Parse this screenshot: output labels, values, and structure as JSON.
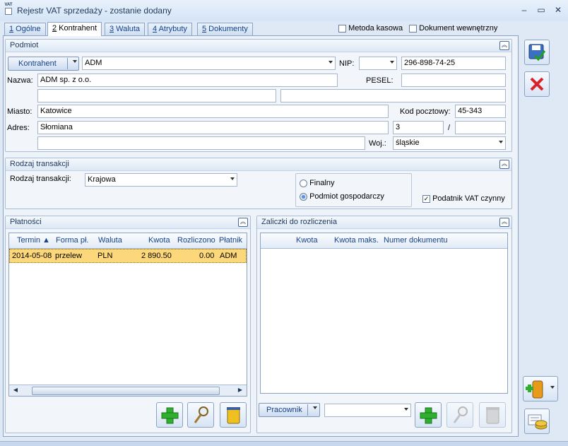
{
  "window": {
    "title": "Rejestr VAT sprzedaży - zostanie dodany",
    "minimize": "–",
    "maximize": "▭",
    "close": "✕"
  },
  "tabs": [
    {
      "num": "1",
      "label": " Ogólne"
    },
    {
      "num": "2",
      "label": " Kontrahent"
    },
    {
      "num": "3",
      "label": " Waluta"
    },
    {
      "num": "4",
      "label": " Atrybuty"
    },
    {
      "num": "5",
      "label": " Dokumenty"
    }
  ],
  "checks": {
    "metoda_kasowa": "Metoda kasowa",
    "dok_wewn": "Dokument wewnętrzny"
  },
  "podmiot": {
    "title": "Podmiot",
    "kontrahent_btn": "Kontrahent",
    "kontrahent_value": "ADM",
    "nip_label": "NIP:",
    "nip_prefix": "",
    "nip_value": "296-898-74-25",
    "nazwa_label": "Nazwa:",
    "nazwa_value": "ADM sp. z o.o.",
    "pesel_label": "PESEL:",
    "pesel_value": "",
    "miasto_label": "Miasto:",
    "miasto_value": "Katowice",
    "kod_label": "Kod pocztowy:",
    "kod_value": "45-343",
    "adres_label": "Adres:",
    "adres_value": "Słomiana",
    "nr_domu": "3",
    "slash": "/",
    "nr_lokalu": "",
    "woj_label": "Woj.:",
    "woj_value": "śląskie"
  },
  "rodzaj": {
    "title": "Rodzaj transakcji",
    "label": "Rodzaj transakcji:",
    "value": "Krajowa",
    "opt_finalny": "Finalny",
    "opt_podmiot": "Podmiot gospodarczy",
    "podatnik": "Podatnik VAT czynny"
  },
  "platnosci": {
    "title": "Płatności",
    "columns": [
      "Termin ▲",
      "Forma pł.",
      "Waluta",
      "Kwota",
      "Rozliczono",
      "Płatnik"
    ],
    "rows": [
      {
        "termin": "2014-05-08",
        "forma": "przelew",
        "waluta": "PLN",
        "kwota": "2 890.50",
        "rozliczono": "0.00",
        "platnik": "ADM"
      }
    ]
  },
  "zaliczki": {
    "title": "Zaliczki do rozliczenia",
    "columns": [
      "Kwota",
      "Kwota maks.",
      "Numer dokumentu"
    ],
    "pracownik_btn": "Pracownik",
    "pracownik_value": ""
  },
  "icons": {
    "save": "save-icon",
    "cancel": "cancel-icon",
    "add": "add-icon",
    "search": "search-icon",
    "trash": "trash-icon"
  }
}
